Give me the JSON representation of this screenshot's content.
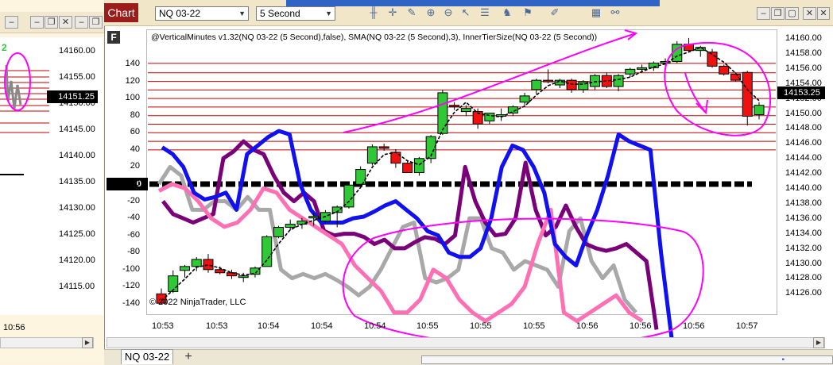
{
  "left_window": {
    "price_labels": [
      "14160.00",
      "14155.00",
      "14150.00",
      "14145.00",
      "14140.00",
      "14135.00",
      "14130.00",
      "14125.00",
      "14120.00",
      "14115.00"
    ],
    "price_tag": "14151.25",
    "time_label": "10:56",
    "marker": "2"
  },
  "toolbar": {
    "chart_tab": "Chart",
    "instrument": "NQ 03-22",
    "interval": "5 Second",
    "icons": [
      "bars-icon",
      "crosshair-icon",
      "pencil-icon",
      "zoom-in-icon",
      "zoom-out-icon",
      "cursor-icon",
      "properties-icon",
      "strategies-icon",
      "indicators-icon",
      "drawing-tools-icon"
    ],
    "window_buttons": [
      "minimize",
      "maximize",
      "close"
    ]
  },
  "chart": {
    "panel_badge": "F",
    "study_title": "@VerticalMinutes v1.32(NQ 03-22 (5 Second),false), SMA(NQ 03-22 (5 Second),3), InnerTierSize(NQ 03-22 (5 Second))",
    "copyright": "© 2022 NinjaTrader, LLC",
    "zero_tag": "0",
    "price_tag": "14153.25",
    "indicator_axis": [
      "140",
      "120",
      "100",
      "80",
      "60",
      "40",
      "20",
      "0",
      "-20",
      "-40",
      "-60",
      "-80",
      "-100",
      "-120",
      "-140"
    ],
    "price_axis": [
      "14160.00",
      "14158.00",
      "14156.00",
      "14154.00",
      "14152.00",
      "14150.00",
      "14148.00",
      "14146.00",
      "14144.00",
      "14142.00",
      "14140.00",
      "14138.00",
      "14136.00",
      "14134.00",
      "14132.00",
      "14130.00",
      "14128.00",
      "14126.00"
    ],
    "time_axis": [
      "10:53",
      "10:53",
      "10:54",
      "10:54",
      "10:54",
      "10:55",
      "10:55",
      "10:55",
      "10:56",
      "10:56",
      "10:56",
      "10:57"
    ],
    "colors": {
      "up_candle": "#2ec934",
      "down_candle": "#f01010",
      "sma": "#000000",
      "level_lines": "#c00000",
      "blue_line": "#1010f0",
      "purple_line": "#7a007a",
      "gray_line": "#a8a8a8",
      "pink_line": "#ff6fb4",
      "annotation": "#ff00ff"
    }
  },
  "chart_data": {
    "type": "candlestick",
    "x": [
      "10:53",
      "10:53",
      "10:54",
      "10:54",
      "10:54",
      "10:55",
      "10:55",
      "10:55",
      "10:56",
      "10:56",
      "10:56",
      "10:57"
    ],
    "ylim_price": [
      14125,
      14161
    ],
    "ylim_indicator": [
      -150,
      150
    ],
    "candles": [
      {
        "o": 14127.5,
        "h": 14128.2,
        "l": 14126.2,
        "c": 14126.3
      },
      {
        "o": 14127.8,
        "h": 14130.5,
        "l": 14127.6,
        "c": 14129.8
      },
      {
        "o": 14130.5,
        "h": 14131.2,
        "l": 14129.6,
        "c": 14131.0
      },
      {
        "o": 14131.0,
        "h": 14132.2,
        "l": 14130.4,
        "c": 14131.9
      },
      {
        "o": 14131.9,
        "h": 14132.6,
        "l": 14130.2,
        "c": 14130.6
      },
      {
        "o": 14130.6,
        "h": 14131.0,
        "l": 14130.0,
        "c": 14130.2
      },
      {
        "o": 14130.2,
        "h": 14130.6,
        "l": 14129.4,
        "c": 14129.8
      },
      {
        "o": 14129.8,
        "h": 14130.2,
        "l": 14129.0,
        "c": 14129.8
      },
      {
        "o": 14130.0,
        "h": 14131.0,
        "l": 14129.6,
        "c": 14130.8
      },
      {
        "o": 14131.0,
        "h": 14135.0,
        "l": 14131.0,
        "c": 14134.8
      },
      {
        "o": 14134.8,
        "h": 14136.2,
        "l": 14134.6,
        "c": 14136.0
      },
      {
        "o": 14136.0,
        "h": 14137.0,
        "l": 14135.6,
        "c": 14136.4
      },
      {
        "o": 14136.4,
        "h": 14137.2,
        "l": 14135.8,
        "c": 14136.8
      },
      {
        "o": 14137.2,
        "h": 14137.8,
        "l": 14136.2,
        "c": 14137.4
      },
      {
        "o": 14136.8,
        "h": 14138.2,
        "l": 14136.6,
        "c": 14137.9
      },
      {
        "o": 14137.9,
        "h": 14138.8,
        "l": 14136.0,
        "c": 14138.6
      },
      {
        "o": 14138.6,
        "h": 14141.8,
        "l": 14138.4,
        "c": 14141.4
      },
      {
        "o": 14141.5,
        "h": 14143.8,
        "l": 14141.0,
        "c": 14143.4
      },
      {
        "o": 14144.2,
        "h": 14146.6,
        "l": 14143.9,
        "c": 14146.3
      },
      {
        "o": 14146.3,
        "h": 14146.7,
        "l": 14145.8,
        "c": 14146.2
      },
      {
        "o": 14145.6,
        "h": 14146.0,
        "l": 14143.6,
        "c": 14144.2
      },
      {
        "o": 14144.2,
        "h": 14144.6,
        "l": 14143.0,
        "c": 14143.0
      },
      {
        "o": 14143.0,
        "h": 14145.0,
        "l": 14142.6,
        "c": 14144.8
      },
      {
        "o": 14144.8,
        "h": 14147.8,
        "l": 14144.2,
        "c": 14147.6
      },
      {
        "o": 14148.0,
        "h": 14153.6,
        "l": 14147.8,
        "c": 14153.2
      },
      {
        "o": 14151.6,
        "h": 14152.0,
        "l": 14151.0,
        "c": 14151.4
      },
      {
        "o": 14150.8,
        "h": 14151.6,
        "l": 14150.2,
        "c": 14151.2
      },
      {
        "o": 14150.8,
        "h": 14151.2,
        "l": 14148.6,
        "c": 14149.2
      },
      {
        "o": 14149.6,
        "h": 14150.6,
        "l": 14149.2,
        "c": 14150.6
      },
      {
        "o": 14150.2,
        "h": 14151.2,
        "l": 14149.6,
        "c": 14150.4
      },
      {
        "o": 14150.6,
        "h": 14151.6,
        "l": 14150.2,
        "c": 14151.4
      },
      {
        "o": 14152.0,
        "h": 14153.2,
        "l": 14151.6,
        "c": 14152.8
      },
      {
        "o": 14153.6,
        "h": 14155.0,
        "l": 14153.0,
        "c": 14154.8
      },
      {
        "o": 14154.8,
        "h": 14156.2,
        "l": 14154.4,
        "c": 14154.6
      },
      {
        "o": 14154.2,
        "h": 14155.0,
        "l": 14153.8,
        "c": 14154.8
      },
      {
        "o": 14154.8,
        "h": 14155.0,
        "l": 14153.2,
        "c": 14153.6
      },
      {
        "o": 14153.6,
        "h": 14154.8,
        "l": 14153.2,
        "c": 14154.6
      },
      {
        "o": 14154.0,
        "h": 14155.6,
        "l": 14153.6,
        "c": 14155.4
      },
      {
        "o": 14155.4,
        "h": 14155.8,
        "l": 14153.8,
        "c": 14154.0
      },
      {
        "o": 14154.0,
        "h": 14155.6,
        "l": 14153.4,
        "c": 14155.4
      },
      {
        "o": 14155.6,
        "h": 14156.4,
        "l": 14155.2,
        "c": 14156.2
      },
      {
        "o": 14156.2,
        "h": 14156.8,
        "l": 14155.8,
        "c": 14156.4
      },
      {
        "o": 14156.4,
        "h": 14157.2,
        "l": 14156.0,
        "c": 14157.0
      },
      {
        "o": 14157.0,
        "h": 14157.6,
        "l": 14156.4,
        "c": 14157.2
      },
      {
        "o": 14157.2,
        "h": 14159.8,
        "l": 14157.0,
        "c": 14159.4
      },
      {
        "o": 14159.4,
        "h": 14160.2,
        "l": 14158.4,
        "c": 14158.6
      },
      {
        "o": 14158.6,
        "h": 14159.2,
        "l": 14157.8,
        "c": 14159.0
      },
      {
        "o": 14158.4,
        "h": 14158.8,
        "l": 14156.4,
        "c": 14156.6
      },
      {
        "o": 14156.6,
        "h": 14156.8,
        "l": 14155.4,
        "c": 14155.6
      },
      {
        "o": 14155.6,
        "h": 14155.8,
        "l": 14154.6,
        "c": 14154.8
      },
      {
        "o": 14155.8,
        "h": 14156.0,
        "l": 14149.0,
        "c": 14150.2
      },
      {
        "o": 14150.4,
        "h": 14152.0,
        "l": 14149.8,
        "c": 14151.6
      }
    ],
    "sma": [
      14126.6,
      14128.0,
      14129.4,
      14130.9,
      14131.2,
      14130.8,
      14130.2,
      14129.9,
      14130.1,
      14131.8,
      14133.9,
      14135.7,
      14136.4,
      14136.9,
      14137.4,
      14138.0,
      14139.3,
      14141.1,
      14143.7,
      14145.3,
      14145.6,
      14144.5,
      14144.0,
      14145.1,
      14148.5,
      14150.7,
      14152.0,
      14150.6,
      14150.3,
      14150.1,
      14150.8,
      14151.5,
      14152.9,
      14154.1,
      14154.7,
      14154.3,
      14154.3,
      14154.6,
      14154.7,
      14154.9,
      14155.2,
      14155.9,
      14156.5,
      14156.9,
      14157.9,
      14158.4,
      14159.0,
      14158.1,
      14157.1,
      14155.7,
      14153.6,
      14152.2
    ],
    "level_lines_indicator": [
      141,
      130,
      120,
      110,
      100,
      90,
      80,
      70,
      60,
      50,
      40
    ],
    "blue_indicator": [
      43,
      35,
      20,
      -10,
      -18,
      -15,
      -10,
      -30,
      35,
      45,
      55,
      62,
      58,
      0,
      -30,
      -45,
      -45,
      -45,
      -40,
      -38,
      -32,
      -25,
      -20,
      -30,
      -40,
      -55,
      -60,
      -80,
      -85,
      -85,
      -75,
      -40,
      20,
      45,
      40,
      20,
      -10,
      -70,
      -85,
      -95,
      -60,
      -30,
      10,
      58,
      50,
      45,
      40,
      -80,
      -180
    ],
    "purple_indicator": [
      -20,
      -35,
      -40,
      -45,
      -40,
      -35,
      30,
      38,
      50,
      40,
      35,
      10,
      -10,
      -20,
      -10,
      -20,
      -55,
      -60,
      -58,
      -58,
      -62,
      -70,
      -65,
      -75,
      -75,
      -68,
      -62,
      -64,
      -70,
      -60,
      20,
      -20,
      -45,
      -60,
      -58,
      -40,
      25,
      -30,
      -60,
      -50,
      -25,
      -50,
      -70,
      -75,
      -78,
      -75,
      -70,
      -80,
      -90,
      -170
    ],
    "gray_indicator": [
      0,
      20,
      10,
      -30,
      -30,
      -20,
      -20,
      -30,
      -15,
      -30,
      -30,
      -100,
      -110,
      -105,
      -110,
      -105,
      -112,
      -120,
      -130,
      -120,
      -100,
      -75,
      -50,
      -45,
      -110,
      -115,
      -110,
      -100,
      -40,
      -40,
      -75,
      -80,
      -100,
      -90,
      -95,
      -100,
      -120,
      -55,
      -40,
      -90,
      -110,
      -95,
      -135,
      -150
    ],
    "pink_indicator": [
      -8,
      0,
      -5,
      -20,
      -40,
      -50,
      -45,
      -30,
      -5,
      -10,
      -30,
      -40,
      -50,
      -60,
      -70,
      -95,
      -110,
      -125,
      -150,
      -150,
      -135,
      -100,
      -110,
      -135,
      -150,
      -160,
      -150,
      -140,
      -120,
      -70,
      -30,
      -150,
      -160,
      -150,
      -140,
      -130,
      -150,
      -160
    ]
  }
}
